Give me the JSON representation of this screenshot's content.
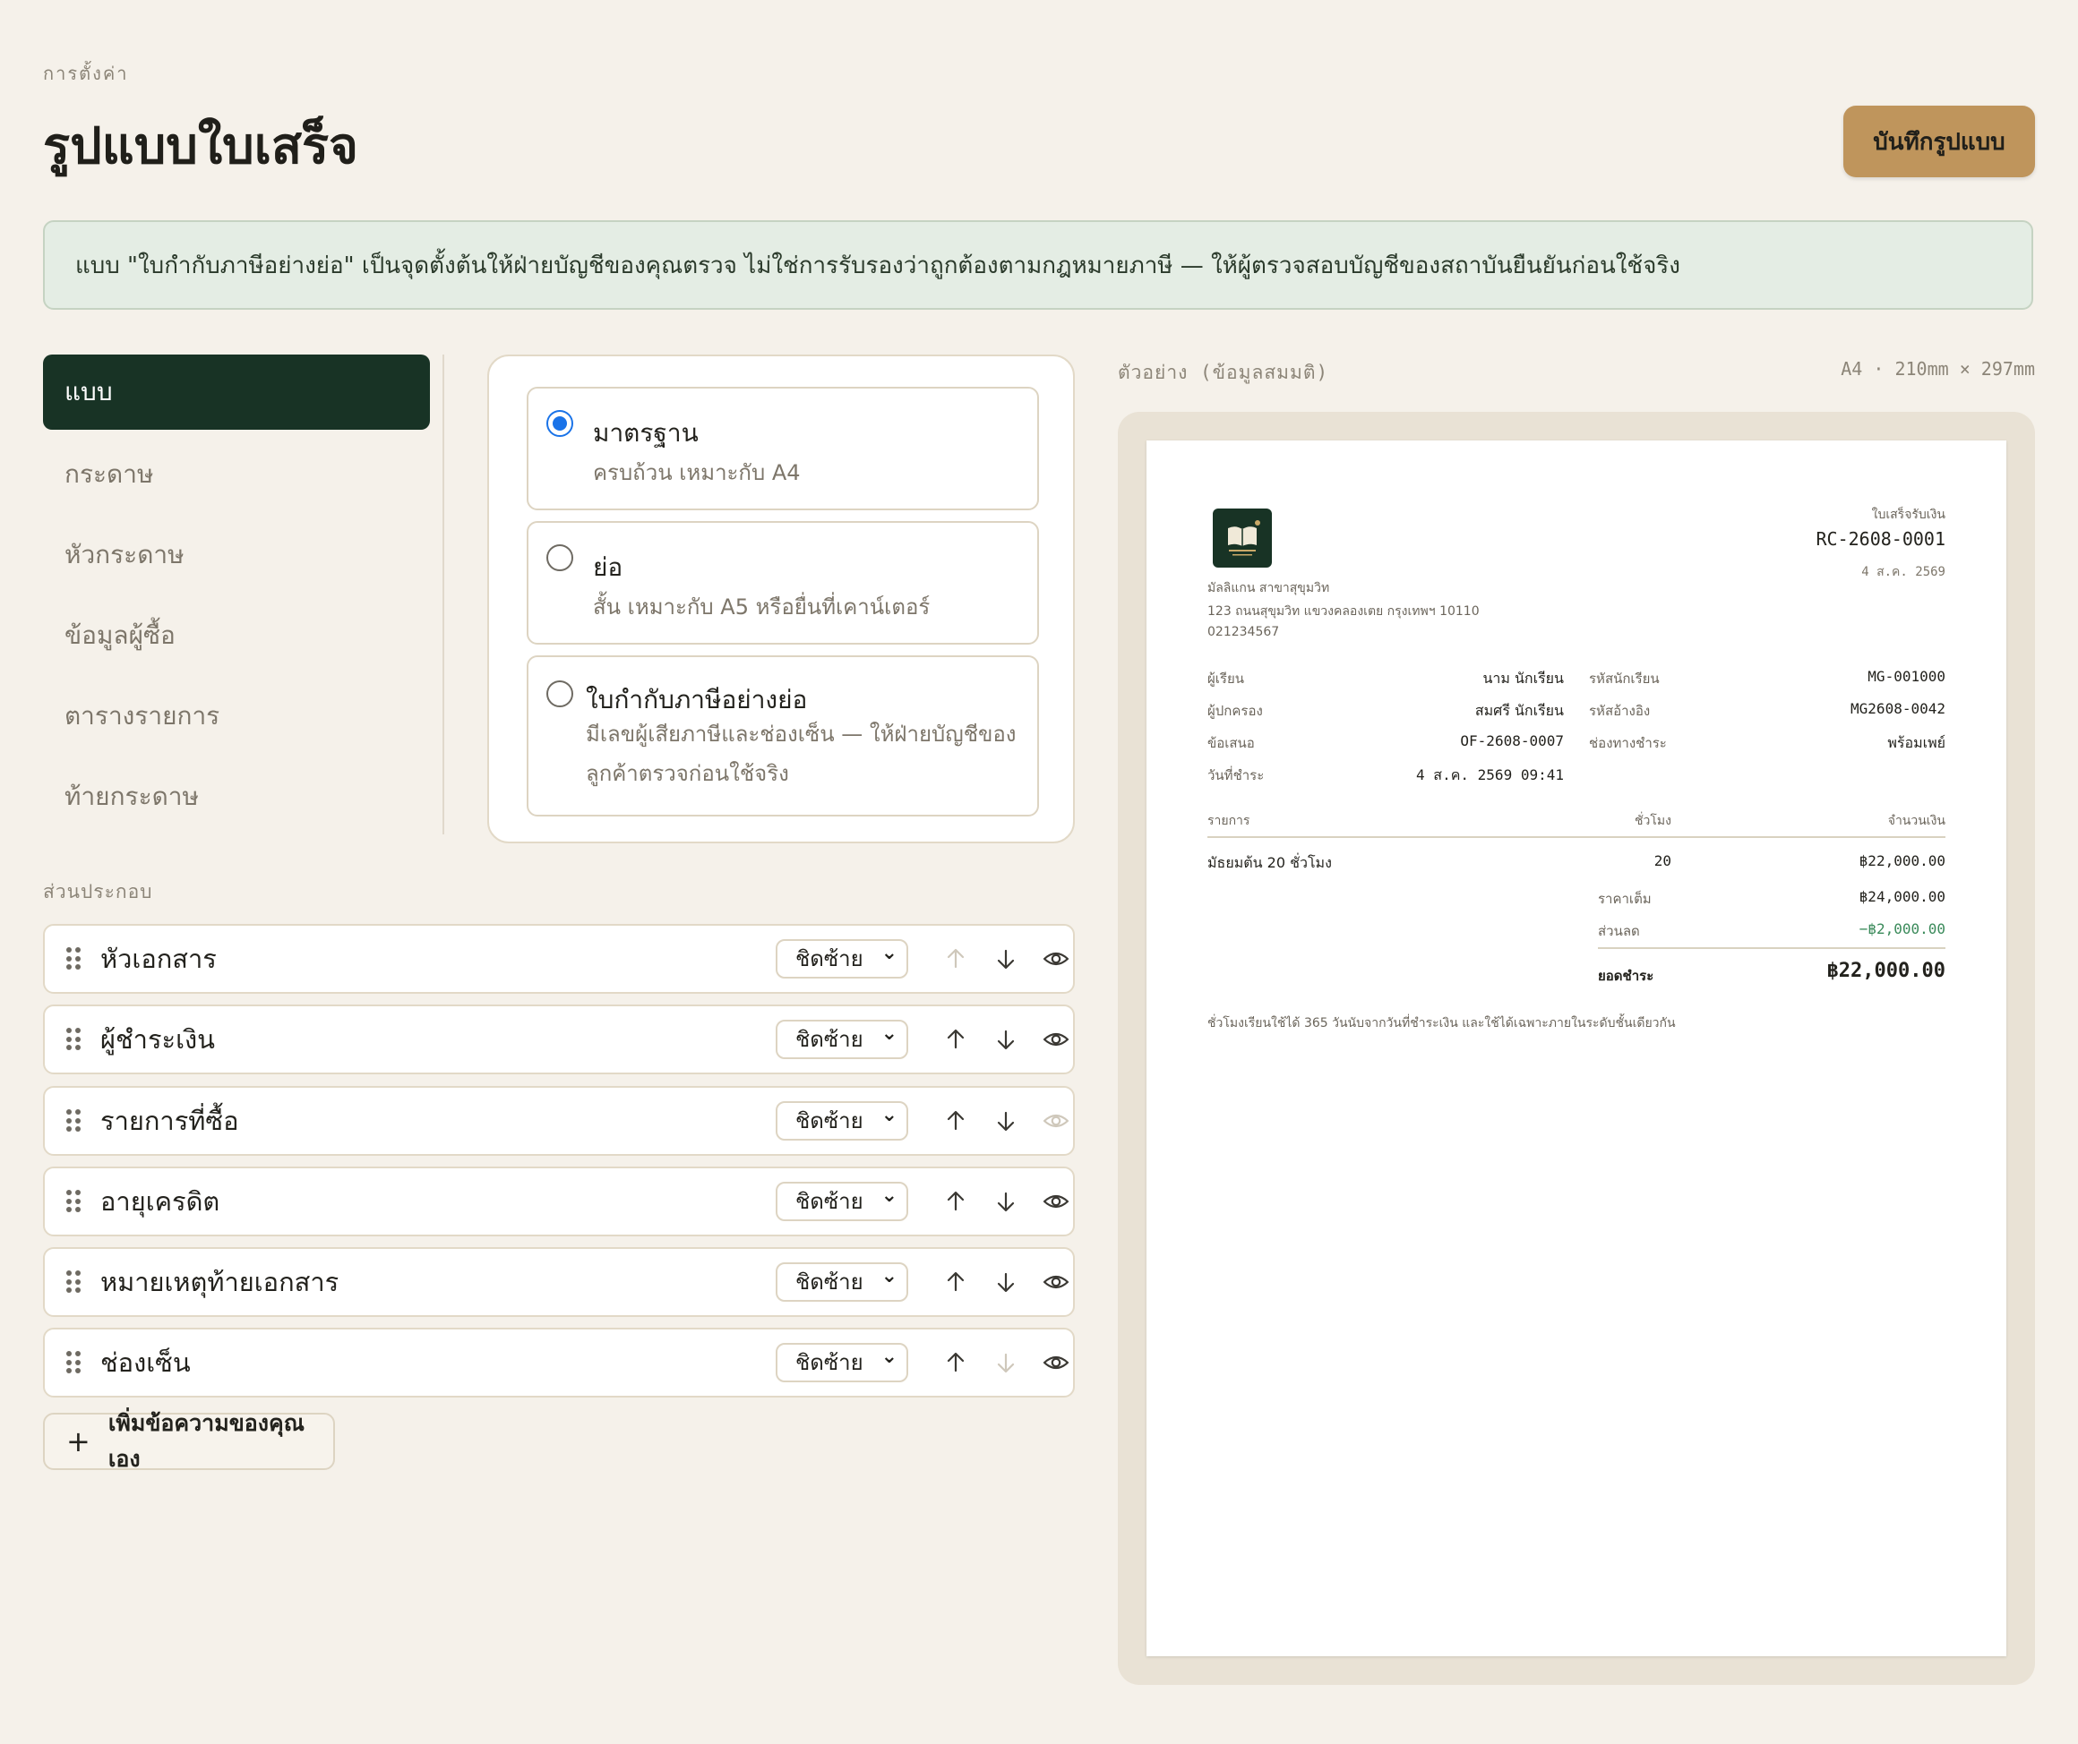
{
  "header": {
    "breadcrumb": "การตั้งค่า",
    "title": "รูปแบบใบเสร็จ",
    "save_label": "บันทึกรูปแบบ"
  },
  "notice": "แบบ \"ใบกำกับภาษีอย่างย่อ\" เป็นจุดตั้งต้นให้ฝ่ายบัญชีของคุณตรวจ ไม่ใช่การรับรองว่าถูกต้องตามกฎหมายภาษี — ให้ผู้ตรวจสอบบัญชีของสถาบันยืนยันก่อนใช้จริง",
  "sidebar": {
    "items": [
      {
        "label": "แบบ",
        "active": true
      },
      {
        "label": "กระดาษ"
      },
      {
        "label": "หัวกระดาษ"
      },
      {
        "label": "ข้อมูลผู้ซื้อ"
      },
      {
        "label": "ตารางรายการ"
      },
      {
        "label": "ท้ายกระดาษ"
      }
    ]
  },
  "styles": {
    "options": [
      {
        "title": "มาตรฐาน",
        "desc": "ครบถ้วน เหมาะกับ A4",
        "selected": true
      },
      {
        "title": "ย่อ",
        "desc": "สั้น เหมาะกับ A5 หรือยื่นที่เคาน์เตอร์",
        "selected": false
      },
      {
        "title": "ใบกำกับภาษีอย่างย่อ",
        "desc_line1": "มีเลขผู้เสียภาษีและช่องเซ็น — ให้ฝ่ายบัญชีของ",
        "desc_line2": "ลูกค้าตรวจก่อนใช้จริง",
        "selected": false
      }
    ]
  },
  "components": {
    "label": "ส่วนประกอบ",
    "rows": [
      {
        "label": "หัวเอกสาร",
        "align": "ชิดซ้าย",
        "up_disabled": true,
        "down_disabled": false,
        "visible": true
      },
      {
        "label": "ผู้ชำระเงิน",
        "align": "ชิดซ้าย",
        "up_disabled": false,
        "down_disabled": false,
        "visible": true
      },
      {
        "label": "รายการที่ซื้อ",
        "align": "ชิดซ้าย",
        "up_disabled": false,
        "down_disabled": false,
        "visible": false
      },
      {
        "label": "อายุเครดิต",
        "align": "ชิดซ้าย",
        "up_disabled": false,
        "down_disabled": false,
        "visible": true
      },
      {
        "label": "หมายเหตุท้ายเอกสาร",
        "align": "ชิดซ้าย",
        "up_disabled": false,
        "down_disabled": false,
        "visible": true
      },
      {
        "label": "ช่องเซ็น",
        "align": "ชิดซ้าย",
        "up_disabled": false,
        "down_disabled": true,
        "visible": true
      }
    ],
    "add_label": "เพิ่มข้อความของคุณเอง"
  },
  "preview": {
    "label": "ตัวอย่าง (ข้อมูลสมมติ)",
    "size": "A4 · 210mm × 297mm",
    "receipt": {
      "doc_type": "ใบเสร็จรับเงิน",
      "number": "RC-2608-0001",
      "date": "4 ส.ค. 2569",
      "org_name": "มัลลิแกน สาขาสุขุมวิท",
      "org_address": "123 ถนนสุขุมวิท แขวงคลองเตย กรุงเทพฯ 10110",
      "org_phone": "021234567",
      "fields_left": [
        {
          "label": "ผู้เรียน",
          "value": "นาม นักเรียน"
        },
        {
          "label": "ผู้ปกครอง",
          "value": "สมศรี นักเรียน"
        },
        {
          "label": "ข้อเสนอ",
          "value": "OF-2608-0007"
        },
        {
          "label": "วันที่ชำระ",
          "value": "4 ส.ค. 2569 09:41"
        }
      ],
      "fields_right": [
        {
          "label": "รหัสนักเรียน",
          "value": "MG-001000"
        },
        {
          "label": "รหัสอ้างอิง",
          "value": "MG2608-0042"
        },
        {
          "label": "ช่องทางชำระ",
          "value": "พร้อมเพย์"
        }
      ],
      "table_headers": {
        "item": "รายการ",
        "hours": "ชั่วโมง",
        "amount": "จำนวนเงิน"
      },
      "items": [
        {
          "name": "มัธยมต้น 20 ชั่วโมง",
          "hours": "20",
          "amount": "฿22,000.00"
        }
      ],
      "subtotal_label": "ราคาเต็ม",
      "subtotal": "฿24,000.00",
      "discount_label": "ส่วนลด",
      "discount": "−฿2,000.00",
      "total_label": "ยอดชำระ",
      "total": "฿22,000.00",
      "footnote": "ชั่วโมงเรียนใช้ได้ 365 วันนับจากวันที่ชำระเงิน และใช้ได้เฉพาะภายในระดับชั้นเดียวกัน"
    }
  },
  "colors": {
    "accent": "#bf955c",
    "sidebar_active": "#183325",
    "notice_bg": "#e4ede4",
    "radio": "#1a73e8",
    "discount": "#3a8a5a"
  }
}
